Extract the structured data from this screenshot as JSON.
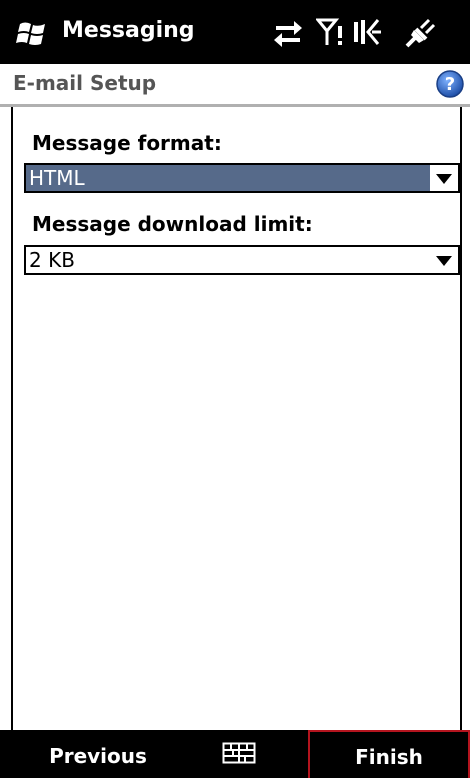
{
  "titlebar": {
    "app_title": "Messaging",
    "icons": [
      "windows-start-icon",
      "connectivity-icon",
      "signal-icon",
      "volume-icon",
      "power-icon"
    ]
  },
  "header": {
    "title": "E-mail Setup",
    "help_icon": "help-icon"
  },
  "form": {
    "message_format": {
      "label": "Message format:",
      "value": "HTML"
    },
    "download_limit": {
      "label": "Message download limit:",
      "value": "2 KB"
    }
  },
  "softkeys": {
    "left": "Previous",
    "center_icon": "keyboard-icon",
    "right": "Finish"
  },
  "colors": {
    "selection": "#566a8a",
    "titlebar": "#000000",
    "accent_border": "#b4141e",
    "help": "#2e6bc6"
  }
}
